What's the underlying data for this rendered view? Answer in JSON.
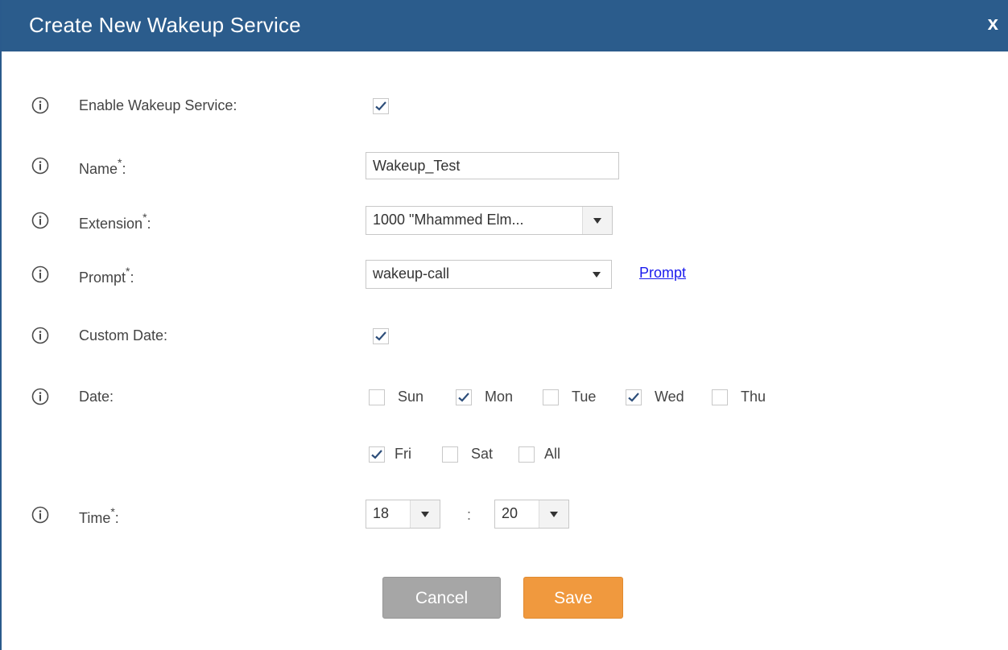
{
  "dialog": {
    "title": "Create New Wakeup Service",
    "close_label": "x"
  },
  "fields": {
    "enable": {
      "label": "Enable Wakeup Service:",
      "checked": true
    },
    "name": {
      "label": "Name",
      "required_mark": "*",
      "suffix": ":",
      "value": "Wakeup_Test"
    },
    "extension": {
      "label": "Extension",
      "required_mark": "*",
      "suffix": ":",
      "value": "1000 \"Mhammed Elm..."
    },
    "prompt": {
      "label": "Prompt",
      "required_mark": "*",
      "suffix": ":",
      "value": "wakeup-call",
      "link_label": "Prompt"
    },
    "custom_date": {
      "label": "Custom Date:",
      "checked": true
    },
    "date": {
      "label": "Date:",
      "days": [
        {
          "label": "Sun",
          "checked": false
        },
        {
          "label": "Mon",
          "checked": true
        },
        {
          "label": "Tue",
          "checked": false
        },
        {
          "label": "Wed",
          "checked": true
        },
        {
          "label": "Thu",
          "checked": false
        },
        {
          "label": "Fri",
          "checked": true
        },
        {
          "label": "Sat",
          "checked": false
        },
        {
          "label": "All",
          "checked": false
        }
      ]
    },
    "time": {
      "label": "Time",
      "required_mark": "*",
      "suffix": ":",
      "hour": "18",
      "separator": ":",
      "minute": "20"
    }
  },
  "buttons": {
    "cancel_label": "Cancel",
    "save_label": "Save"
  },
  "colors": {
    "titlebar": "#2b5c8c",
    "save": "#f0993e",
    "cancel": "#a6a6a6",
    "link": "#1a1aee"
  }
}
